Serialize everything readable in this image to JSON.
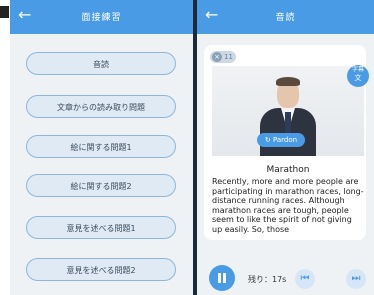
{
  "left_screen": {
    "title": "面接練習",
    "back_icon": "←",
    "menu_items": [
      {
        "label": "音読"
      },
      {
        "label": "文章からの読み取り問題"
      },
      {
        "label": "絵に関する問題1"
      },
      {
        "label": "絵に関する問題2"
      },
      {
        "label": "意見を述べる問題1"
      },
      {
        "label": "意見を述べる問題2"
      }
    ]
  },
  "right_screen": {
    "title": "音読",
    "back_icon": "←",
    "counter": "11",
    "counter_icon": "×",
    "text_toggle": {
      "line1": "字幕",
      "line2": "文"
    },
    "pardon_label": "Pardon",
    "pardon_icon": "↻",
    "passage_title": "Marathon",
    "passage": "Recently, more and more people are participating in marathon races, long-distance running races. Although marathon races are tough, people seem to like the spirit of not giving up easily. So, those",
    "remaining": "残り：17s",
    "prev_icon": "⏮",
    "next_icon": "⏭"
  },
  "colors": {
    "accent": "#4a9be6",
    "background": "#eef2f5"
  }
}
